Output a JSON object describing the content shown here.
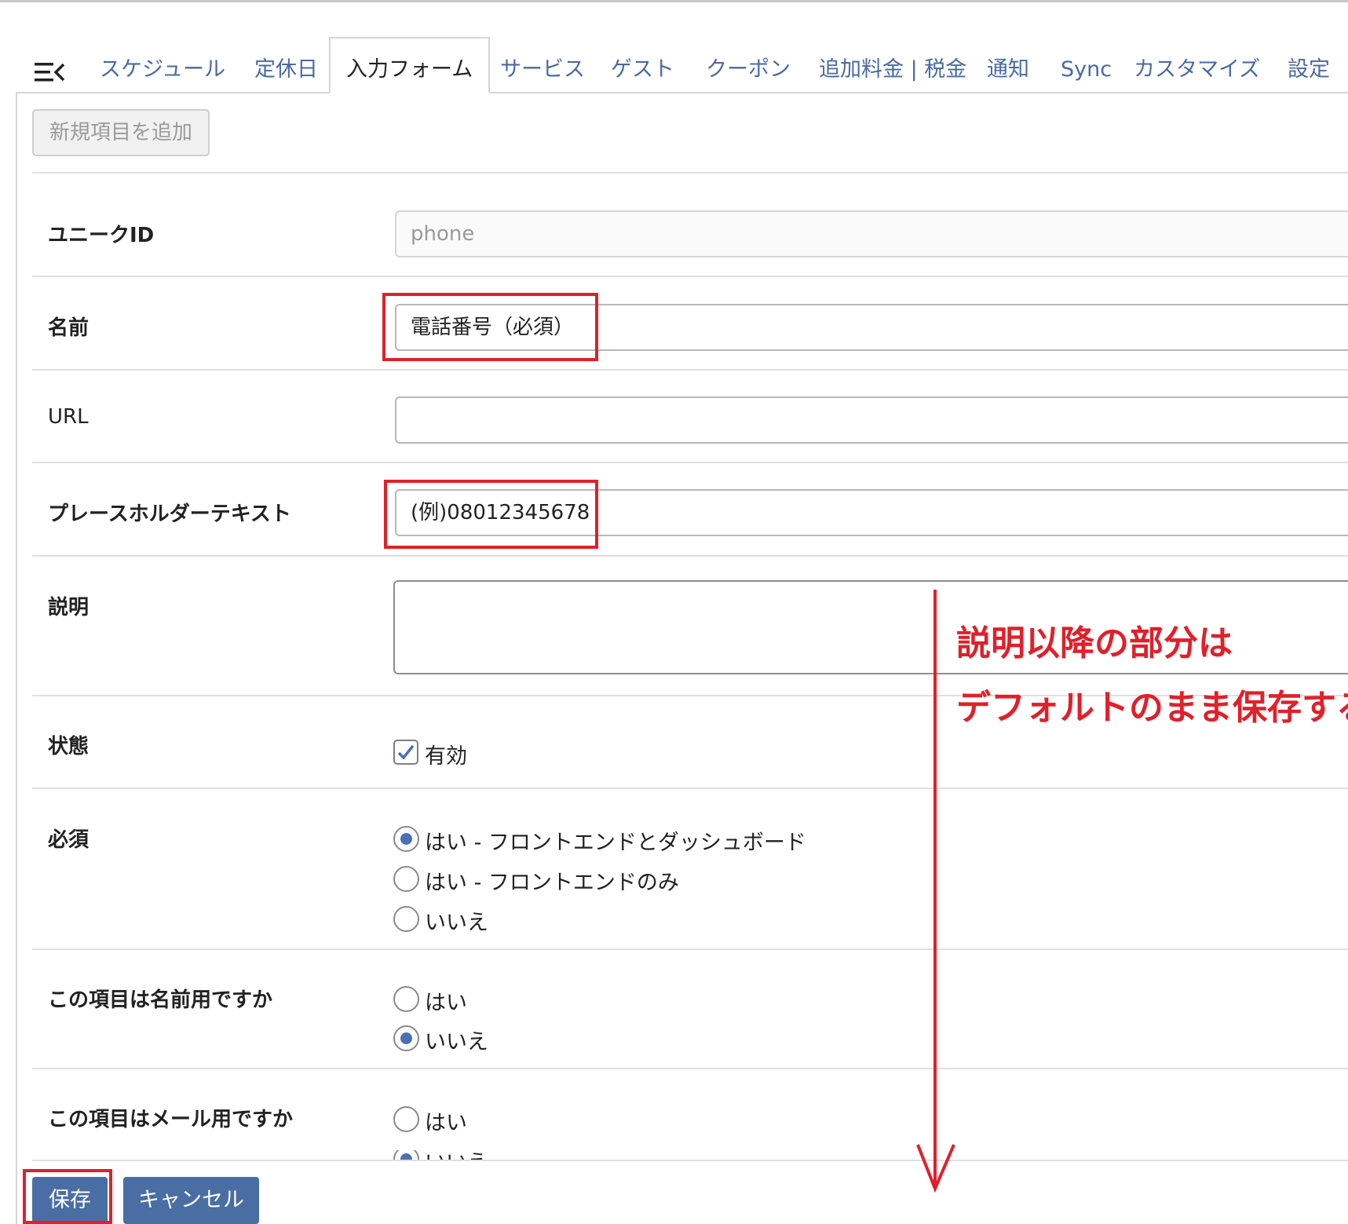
{
  "tabs": [
    {
      "label": "スケジュール"
    },
    {
      "label": "定休日"
    },
    {
      "label": "入力フォーム"
    },
    {
      "label": "サービス"
    },
    {
      "label": "ゲスト"
    },
    {
      "label": "クーポン"
    },
    {
      "label": "追加料金 | 税金"
    },
    {
      "label": "通知"
    },
    {
      "label": "Sync"
    },
    {
      "label": "カスタマイズ"
    },
    {
      "label": "設定"
    }
  ],
  "active_tab": "入力フォーム",
  "toolbar": {
    "add_label": "新規項目を追加"
  },
  "fields": {
    "unique_id": {
      "label": "ユニークID",
      "value": "phone"
    },
    "name": {
      "label": "名前",
      "value": "電話番号（必須）"
    },
    "url": {
      "label": "URL",
      "value": ""
    },
    "placeholder": {
      "label": "プレースホルダーテキスト",
      "value": "(例)08012345678"
    },
    "description": {
      "label": "説明",
      "value": ""
    },
    "status": {
      "label": "状態",
      "checkbox_label": "有効",
      "checked": true
    },
    "required": {
      "label": "必須",
      "options": [
        "はい - フロントエンドとダッシュボード",
        "はい - フロントエンドのみ",
        "いいえ"
      ],
      "selected": "はい - フロントエンドとダッシュボード"
    },
    "is_name": {
      "label": "この項目は名前用ですか",
      "options": [
        "はい",
        "いいえ"
      ],
      "selected": "いいえ"
    },
    "is_email": {
      "label": "この項目はメール用ですか",
      "options": [
        "はい",
        "いいえ"
      ],
      "selected": "いいえ"
    }
  },
  "buttons": {
    "save": "保存",
    "cancel": "キャンセル"
  },
  "annotation": {
    "line1": "説明以降の部分は",
    "line2": "デフォルトのまま保存する"
  },
  "colors": {
    "accent": "#4a6ea3",
    "annotation": "#e0202a",
    "tab_link": "#4a6aa2"
  }
}
